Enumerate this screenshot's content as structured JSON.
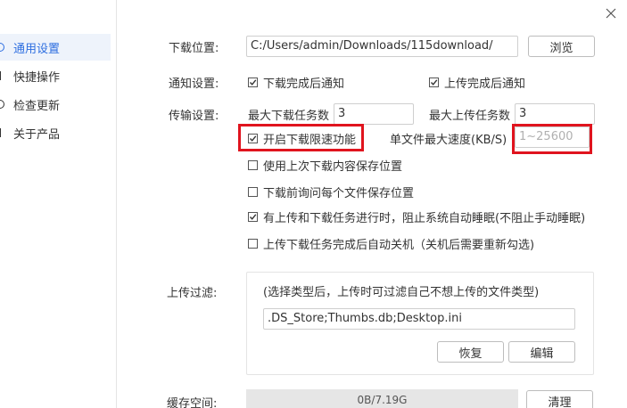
{
  "sidebar": {
    "items": [
      {
        "label": "通用设置",
        "active": true
      },
      {
        "label": "快捷操作",
        "active": false
      },
      {
        "label": "检查更新",
        "active": false
      },
      {
        "label": "关于产品",
        "active": false
      }
    ]
  },
  "download_location": {
    "label": "下载位置:",
    "value": "C:/Users/admin/Downloads/115download/",
    "browse_label": "浏览"
  },
  "notification": {
    "label": "通知设置:",
    "download_done": {
      "label": "下载完成后通知",
      "checked": true
    },
    "upload_done": {
      "label": "上传完成后通知",
      "checked": true
    }
  },
  "transfer": {
    "label": "传输设置:",
    "max_download_label": "最大下载任务数",
    "max_download_value": "3",
    "max_upload_label": "最大上传任务数",
    "max_upload_value": "3",
    "speed_limit": {
      "label": "开启下载限速功能",
      "checked": true
    },
    "max_speed_label": "单文件最大速度(KB/S)",
    "max_speed_placeholder": "1~25600",
    "options": [
      {
        "label": "使用上次下载内容保存位置",
        "checked": false
      },
      {
        "label": "下载前询问每个文件保存位置",
        "checked": false
      },
      {
        "label": "有上传和下载任务进行时，阻止系统自动睡眠(不阻止手动睡眠)",
        "checked": true
      },
      {
        "label": "上传下载任务完成后自动关机（关机后需要重新勾选)",
        "checked": false
      }
    ]
  },
  "upload_filter": {
    "label": "上传过滤:",
    "hint": "(选择类型后，上传时可过滤自己不想上传的文件类型)",
    "value": ".DS_Store;Thumbs.db;Desktop.ini",
    "restore_label": "恢复",
    "edit_label": "编辑"
  },
  "cache": {
    "label": "缓存空间:",
    "usage": "0B/7.19G",
    "clear_label": "清理"
  },
  "colors": {
    "accent": "#2d6ee0",
    "highlight": "#e0141e"
  },
  "icons": {
    "close": "close-icon",
    "check": "check-icon"
  }
}
